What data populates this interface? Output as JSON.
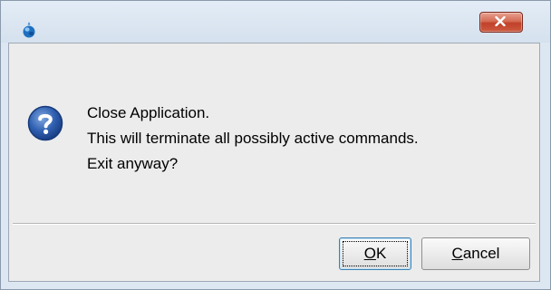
{
  "window": {
    "title": "",
    "close_label": "x"
  },
  "dialog": {
    "message_lines": [
      "Close Application.",
      "This will terminate all possibly active commands.",
      "Exit anyway?"
    ],
    "icon": "question-icon"
  },
  "buttons": {
    "ok": {
      "mnemonic": "O",
      "rest": "K",
      "focused": true
    },
    "cancel": {
      "mnemonic": "C",
      "rest": "ancel"
    }
  },
  "colors": {
    "title_bar": "#dde7f2",
    "close_button": "#c7452e",
    "client_background": "#ececec",
    "question_icon": "#2a5aa8",
    "focus_border": "#3c7fb1"
  }
}
